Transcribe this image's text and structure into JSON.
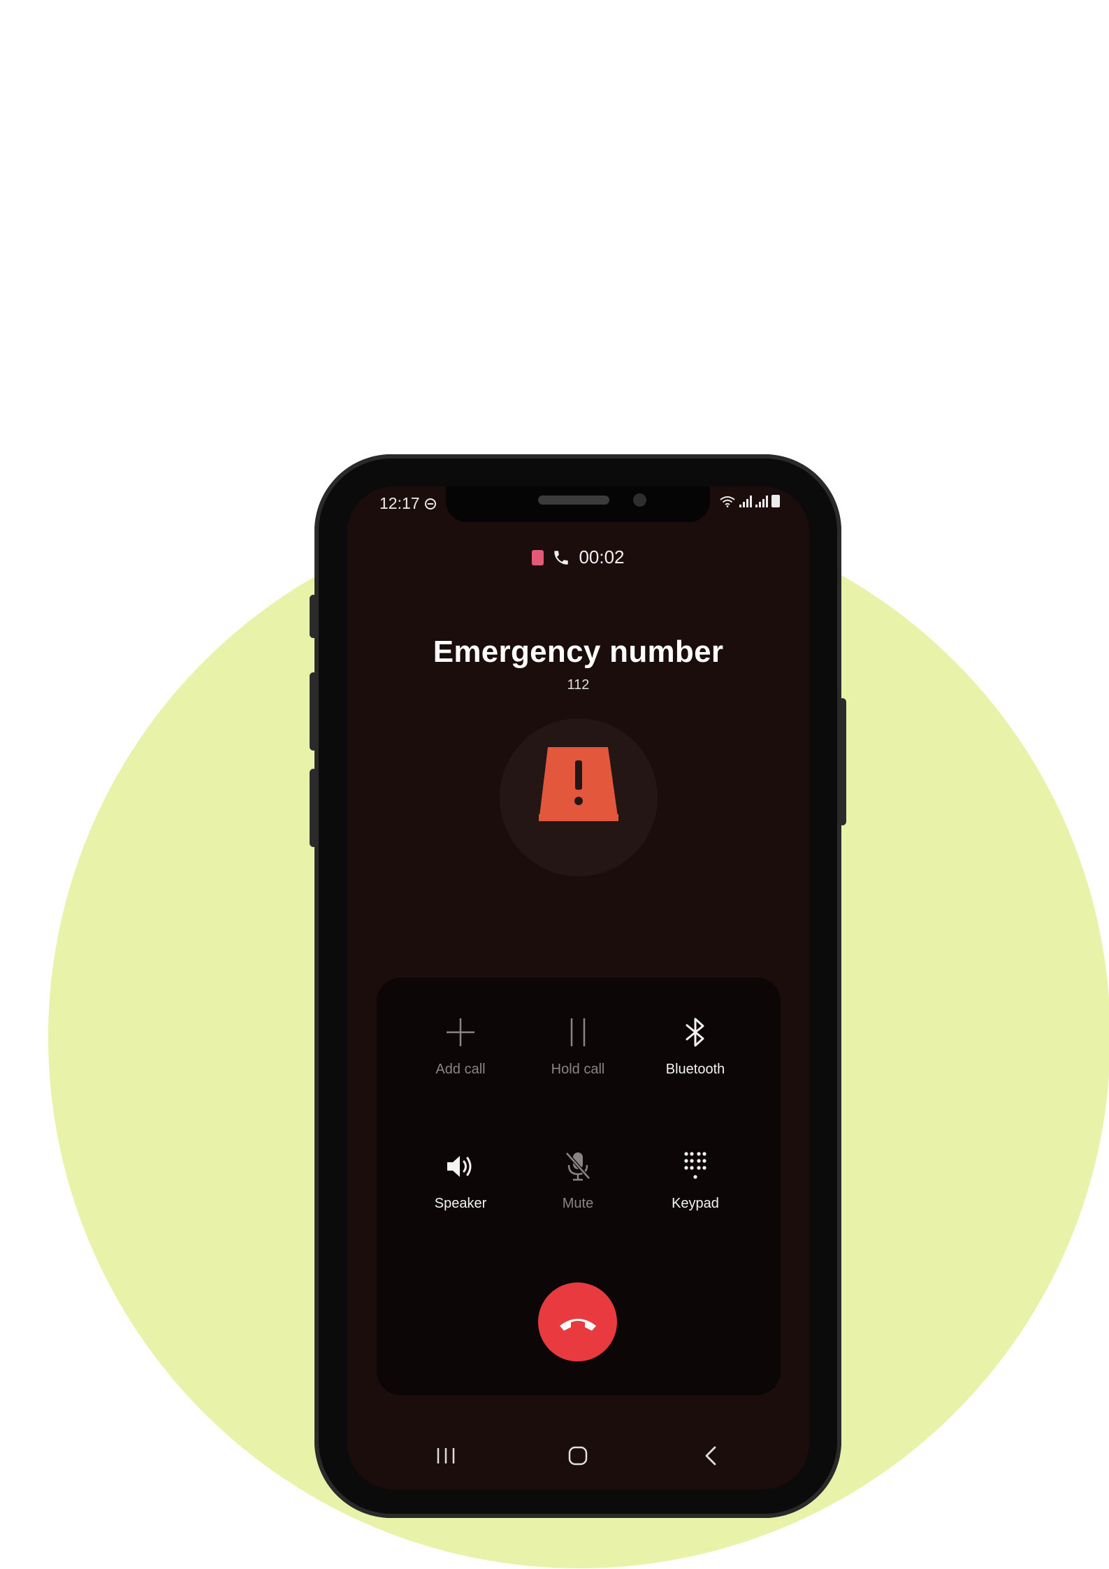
{
  "status_bar": {
    "time": "12:17"
  },
  "call": {
    "duration": "00:02",
    "title": "Emergency number",
    "number": "112"
  },
  "controls": [
    {
      "label": "Add call",
      "icon": "plus-icon",
      "enabled": false
    },
    {
      "label": "Hold call",
      "icon": "pause-icon",
      "enabled": false
    },
    {
      "label": "Bluetooth",
      "icon": "bluetooth-icon",
      "enabled": true
    },
    {
      "label": "Speaker",
      "icon": "speaker-icon",
      "enabled": true
    },
    {
      "label": "Mute",
      "icon": "mic-off-icon",
      "enabled": false
    },
    {
      "label": "Keypad",
      "icon": "keypad-icon",
      "enabled": true
    }
  ],
  "colors": {
    "screen_bg": "#1a0d0c",
    "panel_bg": "#0d0606",
    "end_call": "#e83a3f",
    "warning": "#e3583c",
    "backdrop_circle": "#e8f2a9"
  }
}
